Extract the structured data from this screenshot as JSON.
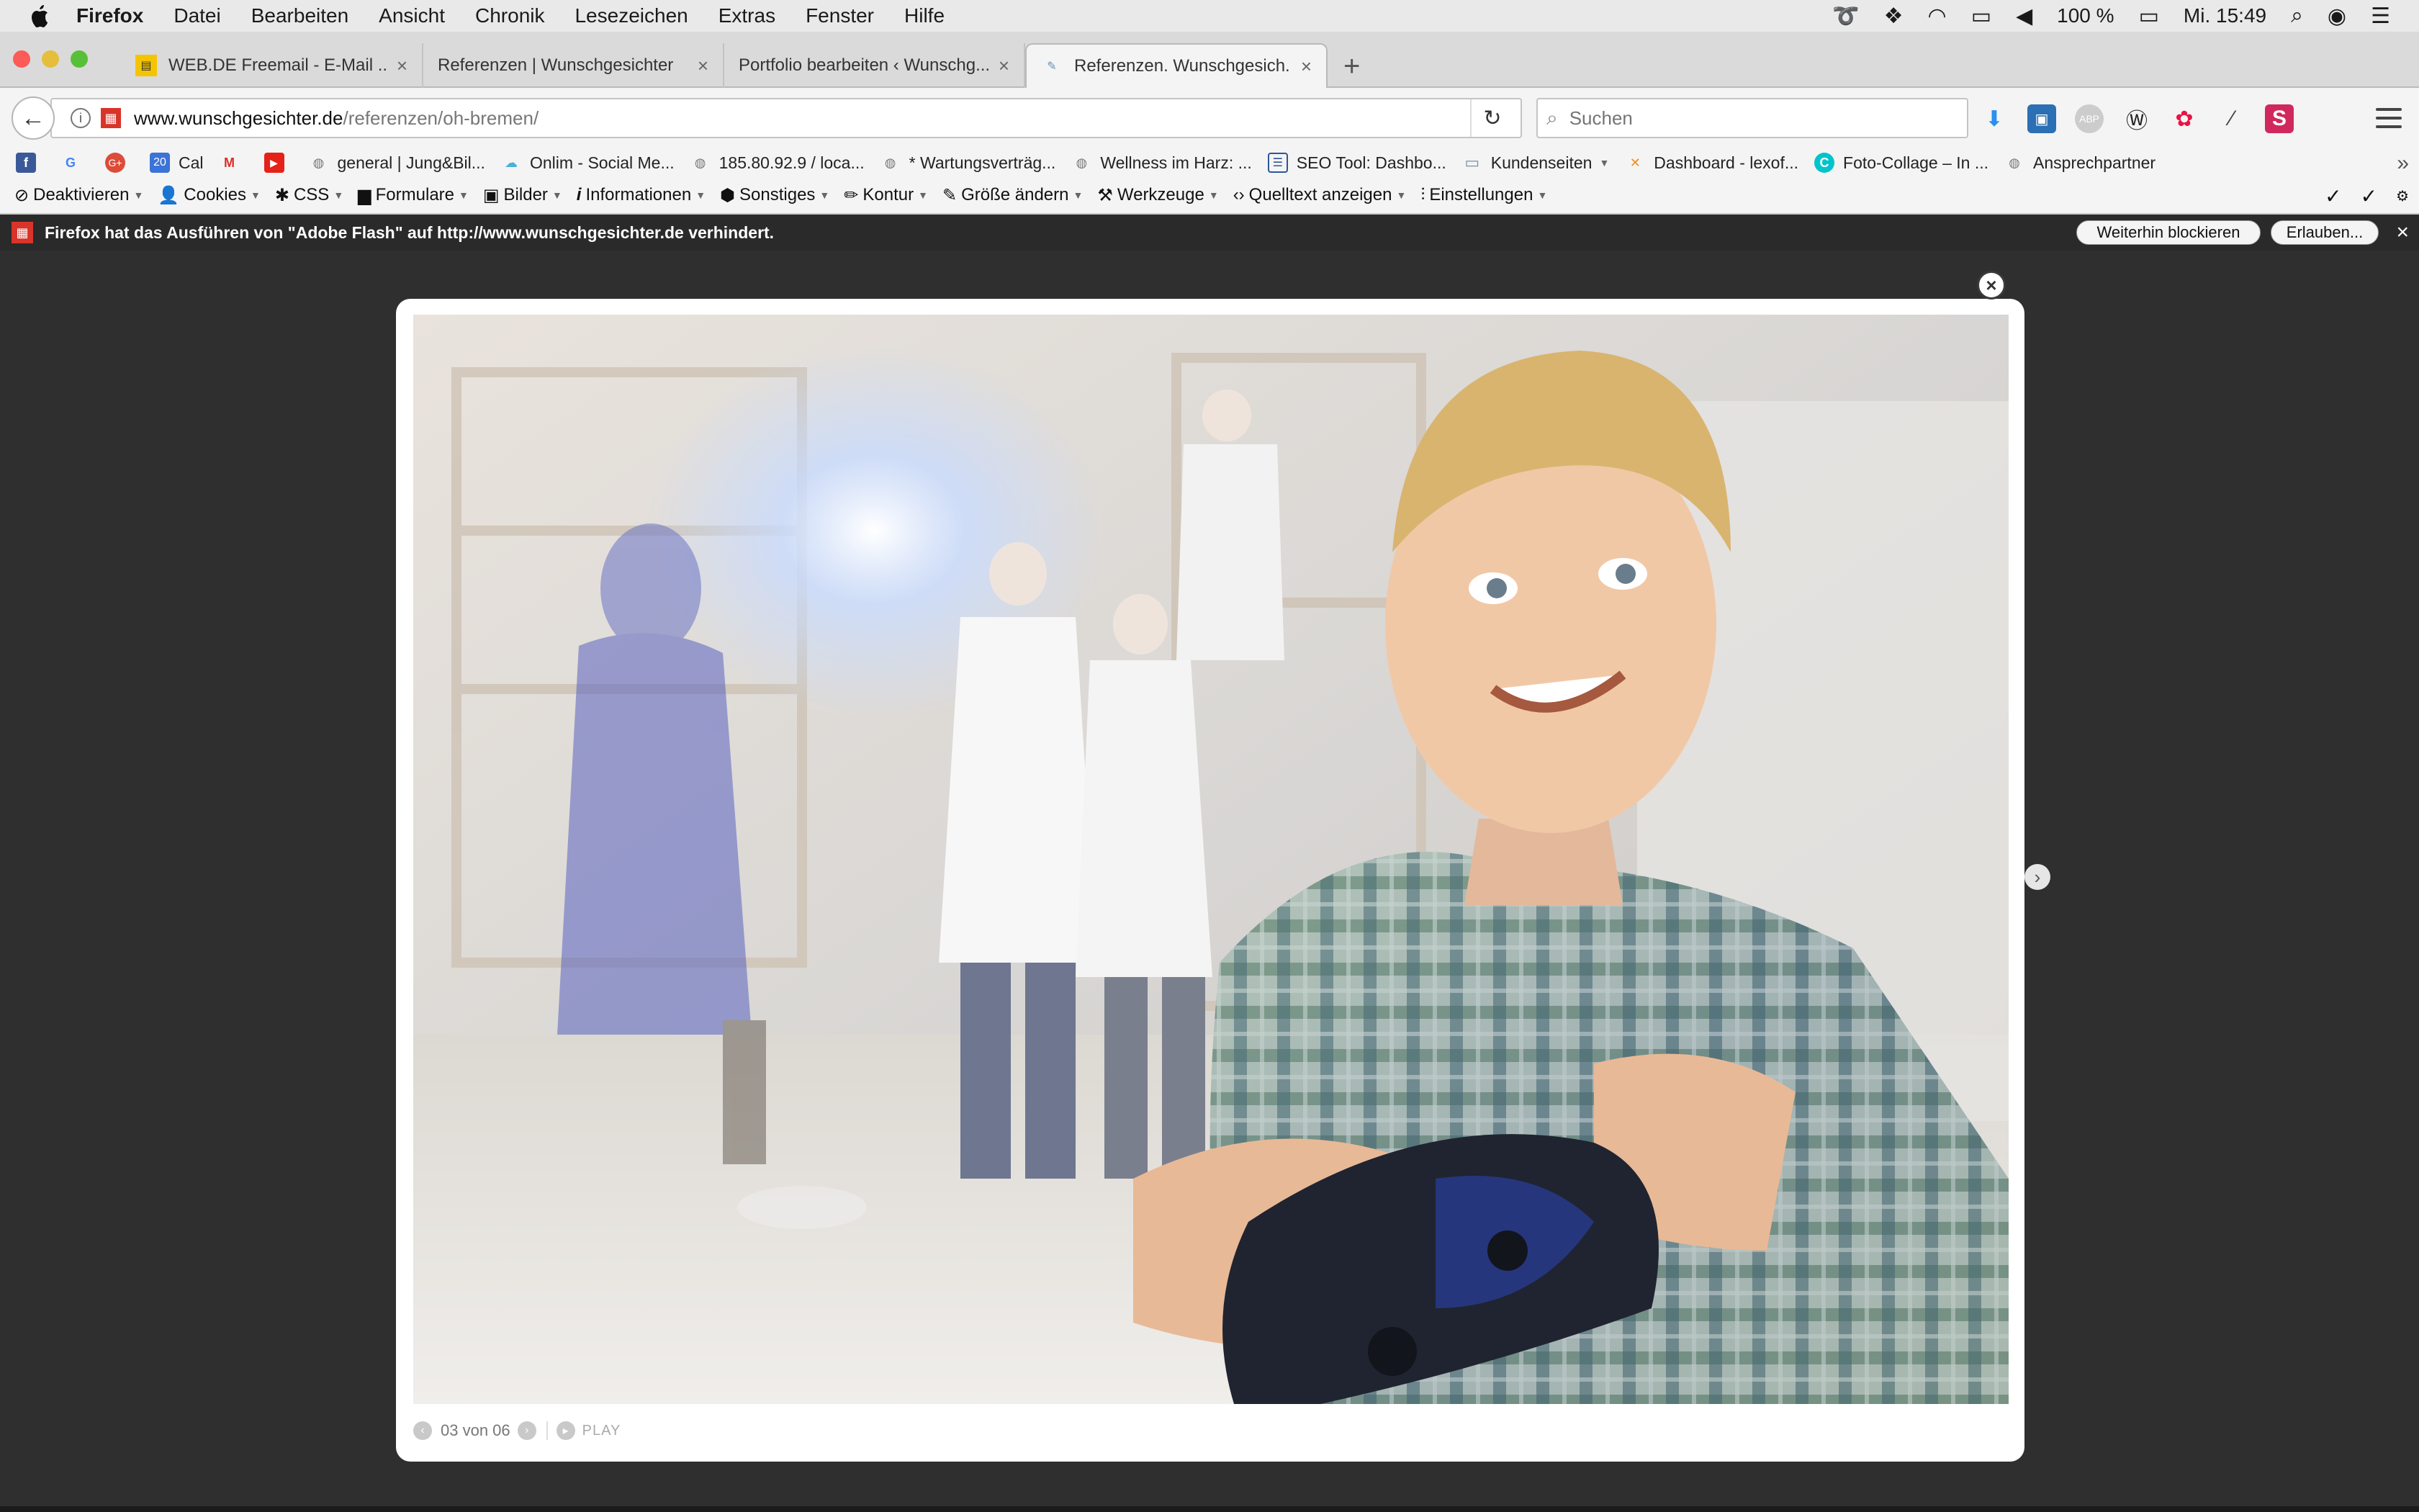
{
  "menubar": {
    "items": [
      "Firefox",
      "Datei",
      "Bearbeiten",
      "Ansicht",
      "Chronik",
      "Lesezeichen",
      "Extras",
      "Fenster",
      "Hilfe"
    ],
    "battery": "100 %",
    "clock": "Mi. 15:49"
  },
  "tabs": [
    {
      "label": "WEB.DE Freemail - E-Mail ...",
      "favicon": "webde-icon"
    },
    {
      "label": "Referenzen | Wunschgesichter",
      "favicon": ""
    },
    {
      "label": "Portfolio bearbeiten ‹ Wunschg...",
      "favicon": ""
    },
    {
      "label": "Referenzen. Wunschgesich...",
      "favicon": "page-icon"
    }
  ],
  "nav": {
    "url_domain": "www.wunschgesichter.de",
    "url_path": "/referenzen/oh-bremen/",
    "search_placeholder": "Suchen"
  },
  "bookmarks": [
    {
      "label": "",
      "icon": "facebook-icon"
    },
    {
      "label": "",
      "icon": "google-icon"
    },
    {
      "label": "",
      "icon": "google-plus-icon"
    },
    {
      "label": "Cal",
      "icon": "calendar-icon",
      "icon_text": "20"
    },
    {
      "label": "",
      "icon": "gmail-icon"
    },
    {
      "label": "",
      "icon": "youtube-icon"
    },
    {
      "label": "general | Jung&Bil...",
      "icon": "globe-icon"
    },
    {
      "label": "Onlim - Social Me...",
      "icon": "onlim-icon"
    },
    {
      "label": "185.80.92.9 / loca...",
      "icon": "globe-icon"
    },
    {
      "label": "* Wartungsverträg...",
      "icon": "globe-icon"
    },
    {
      "label": "Wellness im Harz: ...",
      "icon": "globe-icon"
    },
    {
      "label": "SEO Tool: Dashbo...",
      "icon": "seo-icon"
    },
    {
      "label": "Kundenseiten",
      "icon": "folder-icon",
      "dropdown": true
    },
    {
      "label": "Dashboard - lexof...",
      "icon": "lexoffice-icon"
    },
    {
      "label": "Foto-Collage – In ...",
      "icon": "canva-icon"
    },
    {
      "label": "Ansprechpartner",
      "icon": "globe-icon"
    }
  ],
  "devtoolbar": [
    {
      "label": "Deaktivieren",
      "icon": "disable-icon"
    },
    {
      "label": "Cookies",
      "icon": "user-icon"
    },
    {
      "label": "CSS",
      "icon": "css-wand-icon"
    },
    {
      "label": "Formulare",
      "icon": "forms-icon"
    },
    {
      "label": "Bilder",
      "icon": "images-icon"
    },
    {
      "label": "Informationen",
      "icon": "info-icon"
    },
    {
      "label": "Sonstiges",
      "icon": "misc-icon"
    },
    {
      "label": "Kontur",
      "icon": "outline-pencil-icon"
    },
    {
      "label": "Größe ändern",
      "icon": "resize-pencil-icon"
    },
    {
      "label": "Werkzeuge",
      "icon": "tools-icon"
    },
    {
      "label": "Quelltext anzeigen",
      "icon": "source-icon"
    },
    {
      "label": "Einstellungen",
      "icon": "settings-icon"
    }
  ],
  "flashbar": {
    "message": "Firefox hat das Ausführen von \"Adobe Flash\" auf http://www.wunschgesichter.de verhindert.",
    "block_button": "Weiterhin blockieren",
    "allow_button": "Erlauben..."
  },
  "lightbox": {
    "counter": "03 von 06",
    "play_label": "PLAY"
  },
  "colors": {
    "page_bg": "#2f2f2f",
    "flash_bar": "#2a2a2a",
    "flash_icon": "#d9342a"
  }
}
